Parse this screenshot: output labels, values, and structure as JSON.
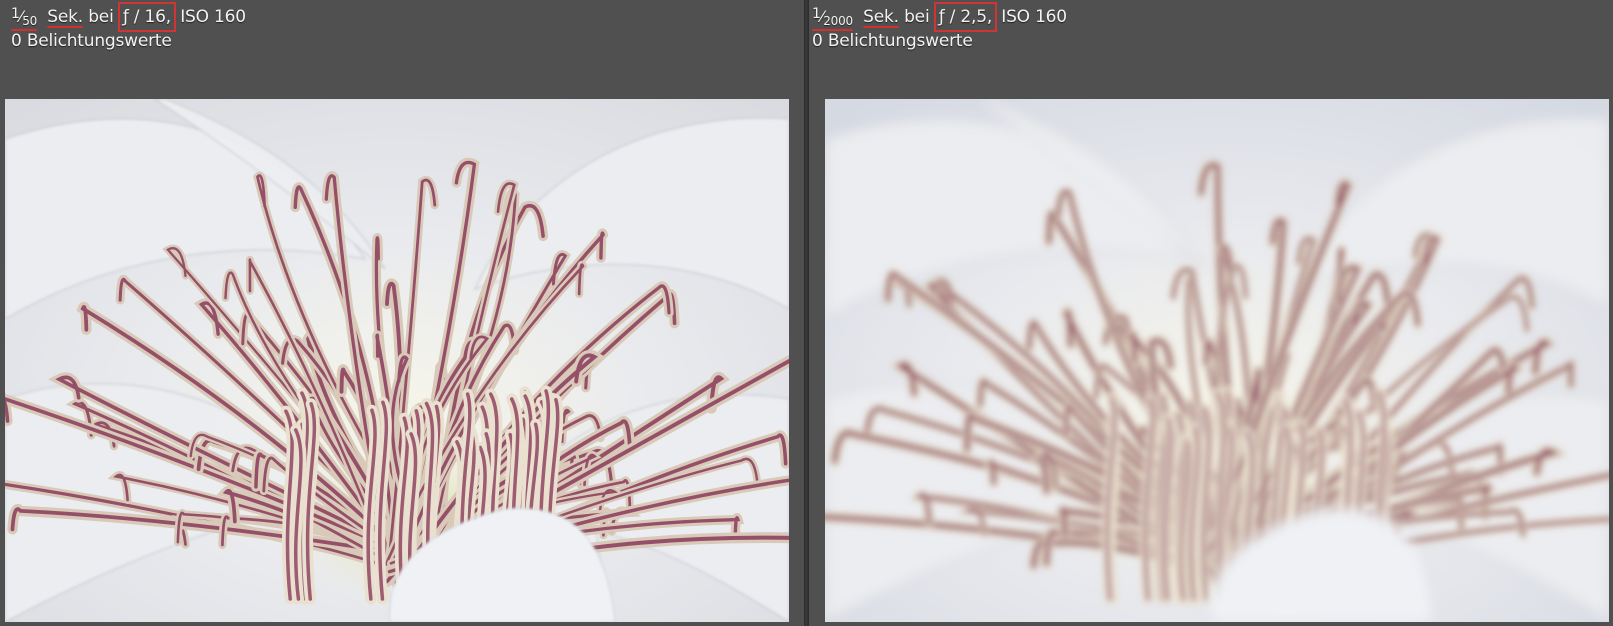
{
  "left": {
    "shutter_num": "1",
    "shutter_den": "50",
    "sek": "Sek.",
    "bei": "bei",
    "aperture": "ƒ / 16,",
    "iso": "ISO 160",
    "exposure": "0 Belichtungswerte",
    "focus": "sharp"
  },
  "right": {
    "shutter_num": "1",
    "shutter_den": "2000",
    "sek": "Sek.",
    "bei": "bei",
    "aperture": "ƒ / 2,5,",
    "iso": "ISO 160",
    "exposure": "0 Belichtungswerte",
    "focus": "blurred"
  },
  "colors": {
    "background": "#4f4f4f",
    "highlight_box": "#d03535",
    "text": "#f2f2f2",
    "petal": "#eceef1",
    "stamen_stripe": "#8a3a5a",
    "center_green": "#d8d98a"
  }
}
